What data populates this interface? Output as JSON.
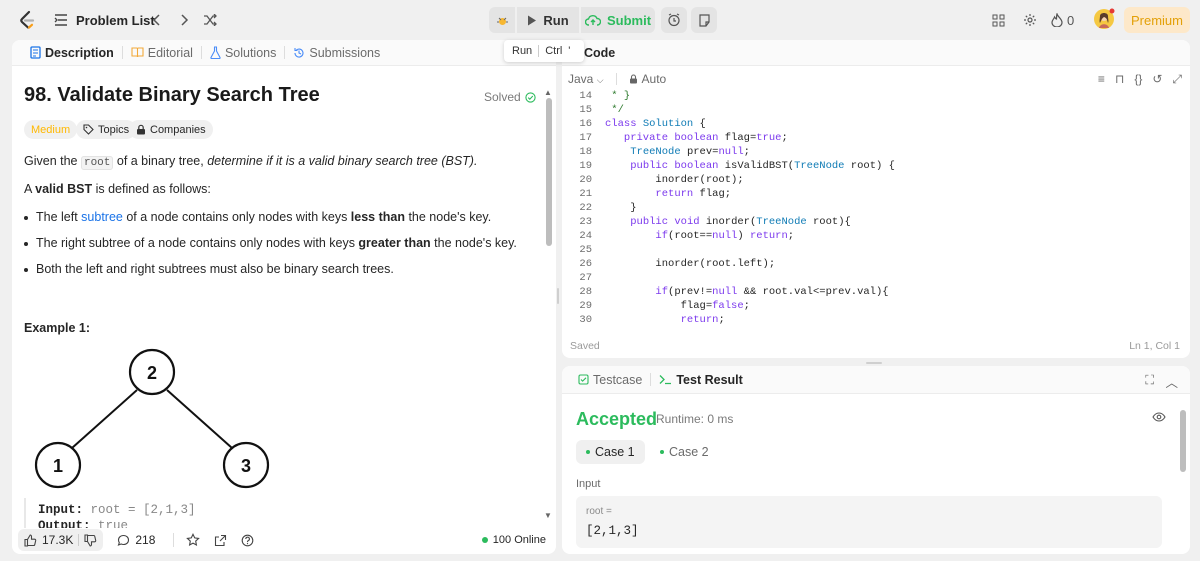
{
  "header": {
    "problem_list": "Problem List",
    "run": "Run",
    "submit": "Submit",
    "streak_count": "0",
    "premium": "Premium"
  },
  "tooltip": {
    "label": "Run",
    "shortcut_ctrl": "Ctrl",
    "shortcut_key": "'"
  },
  "left_tabs": [
    {
      "label": "Description"
    },
    {
      "label": "Editorial"
    },
    {
      "label": "Solutions"
    },
    {
      "label": "Submissions"
    }
  ],
  "problem": {
    "title": "98. Validate Binary Search Tree",
    "status": "Solved",
    "difficulty": "Medium",
    "topics": "Topics",
    "companies": "Companies",
    "desc_prefix": "Given the ",
    "desc_root": "root",
    "desc_mid": " of a binary tree, ",
    "desc_italic": "determine if it is a valid binary search tree (BST).",
    "valid_prefix": "A ",
    "valid_bold": "valid BST",
    "valid_suffix": " is defined as follows:",
    "bullets": [
      {
        "a": "The left ",
        "link": "subtree",
        "b": " of a node contains only nodes with keys ",
        "bold": "less than",
        "c": " the node's key."
      },
      {
        "a": "The right subtree of a node contains only nodes with keys ",
        "bold": "greater than",
        "c": " the node's key."
      },
      {
        "a": "Both the left and right subtrees must also be binary search trees."
      }
    ],
    "example_title": "Example 1:",
    "tree_nodes": {
      "root": "2",
      "left": "1",
      "right": "3"
    },
    "example_input_label": "Input:",
    "example_input_value": " root = [2,1,3]",
    "example_output_label": "Output:",
    "example_output_value": " true"
  },
  "left_footer": {
    "likes": "17.3K",
    "comments": "218",
    "online": "100 Online"
  },
  "code_panel": {
    "tab": "Code",
    "language": "Java",
    "auto": "Auto",
    "saved": "Saved",
    "cursor": "Ln 1, Col 1",
    "lines": [
      {
        "n": "14",
        "t": " * }"
      },
      {
        "n": "15",
        "t": " */"
      },
      {
        "n": "16",
        "t": "class Solution {"
      },
      {
        "n": "17",
        "t": "   private boolean flag=true;"
      },
      {
        "n": "18",
        "t": "    TreeNode prev=null;"
      },
      {
        "n": "19",
        "t": "    public boolean isValidBST(TreeNode root) {"
      },
      {
        "n": "20",
        "t": "        inorder(root);"
      },
      {
        "n": "21",
        "t": "        return flag;"
      },
      {
        "n": "22",
        "t": "    }"
      },
      {
        "n": "23",
        "t": "    public void inorder(TreeNode root){"
      },
      {
        "n": "24",
        "t": "        if(root==null) return;"
      },
      {
        "n": "25",
        "t": ""
      },
      {
        "n": "26",
        "t": "        inorder(root.left);"
      },
      {
        "n": "27",
        "t": ""
      },
      {
        "n": "28",
        "t": "        if(prev!=null && root.val<=prev.val){"
      },
      {
        "n": "29",
        "t": "            flag=false;"
      },
      {
        "n": "30",
        "t": "            return;"
      }
    ]
  },
  "result_panel": {
    "tab_testcase": "Testcase",
    "tab_result": "Test Result",
    "status": "Accepted",
    "runtime": "Runtime: 0 ms",
    "cases": [
      "Case 1",
      "Case 2"
    ],
    "input_label": "Input",
    "var_name": "root =",
    "var_value": "[2,1,3]"
  },
  "colors": {
    "accent_green": "#2cbb5d",
    "medium": "#ffb800",
    "premium_text": "#e3a008"
  }
}
